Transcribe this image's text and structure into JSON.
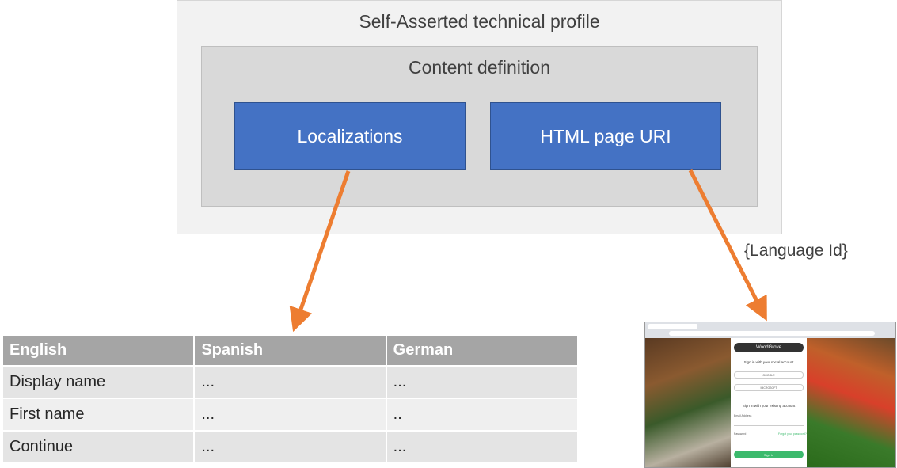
{
  "diagram": {
    "outer_title": "Self-Asserted technical profile",
    "inner_title": "Content definition",
    "box_localizations": "Localizations",
    "box_html_page_uri": "HTML page URI",
    "language_id_label": "{Language Id}",
    "arrow_color": "#ed7d31",
    "box_color": "#4472c4"
  },
  "table": {
    "headers": [
      "English",
      "Spanish",
      "German"
    ],
    "rows": [
      [
        "Display name",
        "...",
        "..."
      ],
      [
        "First name",
        "...",
        ".."
      ],
      [
        "Continue",
        "...",
        "..."
      ]
    ]
  },
  "screenshot": {
    "brand": "WoodGrove",
    "social_heading": "Sign in with your social account",
    "google_button": "GOOGLE",
    "microsoft_button": "MICROSOFT",
    "existing_heading": "Sign in with your existing account",
    "email_label": "Email Address",
    "password_label": "Password",
    "forgot_link": "Forgot your password?",
    "signin_button": "Sign in"
  }
}
